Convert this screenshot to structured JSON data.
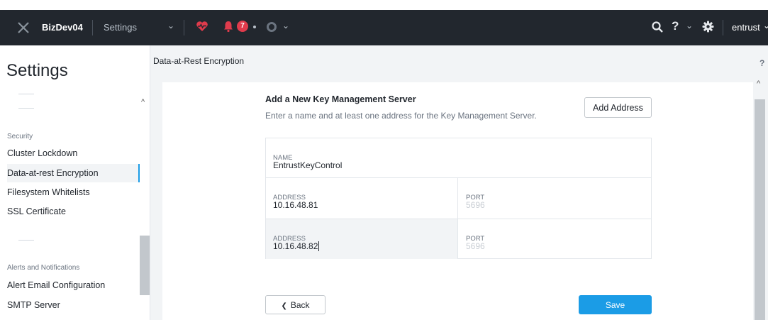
{
  "topbar": {
    "cluster_name": "BizDev04",
    "section": "Settings",
    "alert_count": "7",
    "user": "entrust",
    "help": "?"
  },
  "sidebar": {
    "title": "Settings",
    "security_heading": "Security",
    "security_items": [
      "Cluster Lockdown",
      "Data-at-rest Encryption",
      "Filesystem Whitelists",
      "SSL Certificate"
    ],
    "active_item": "Data-at-rest Encryption",
    "alerts_heading": "Alerts and Notifications",
    "alerts_items": [
      "Alert Email Configuration",
      "SMTP Server"
    ]
  },
  "main": {
    "title": "Data-at-Rest Encryption",
    "help": "?",
    "heading": "Add a New Key Management Server",
    "subtitle": "Enter a name and at least one address for the Key Management Server.",
    "add_address_label": "Add Address",
    "name_label": "NAME",
    "name_value": "EntrustKeyControl",
    "addresses": [
      {
        "address_label": "ADDRESS",
        "address_value": "10.16.48.81",
        "port_label": "PORT",
        "port_placeholder": "5696"
      },
      {
        "address_label": "ADDRESS",
        "address_value": "10.16.48.82",
        "port_label": "PORT",
        "port_placeholder": "5696"
      }
    ],
    "back_label": "Back",
    "save_label": "Save"
  },
  "colors": {
    "topbar_bg": "#22272e",
    "accent": "#1b9ce6",
    "alert_badge": "#e03b4c",
    "health_icon": "#e03b4c"
  }
}
